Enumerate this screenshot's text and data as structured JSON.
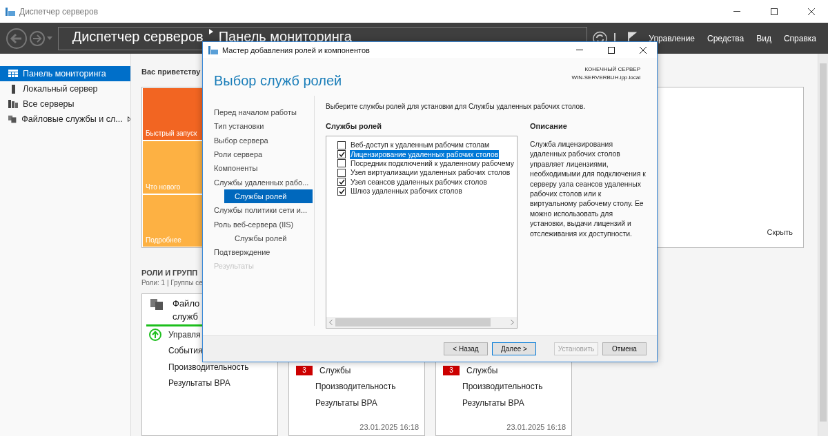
{
  "window": {
    "title": "Диспетчер серверов"
  },
  "toolbar": {
    "breadcrumb": [
      "Диспетчер серверов",
      "Панель мониторинга"
    ],
    "menu": [
      "Управление",
      "Средства",
      "Вид",
      "Справка"
    ]
  },
  "sidebar": {
    "items": [
      {
        "label": "Панель мониторинга",
        "kind": "dashboard",
        "selected": true,
        "has_submenu": false
      },
      {
        "label": "Локальный сервер",
        "kind": "server",
        "selected": false,
        "has_submenu": false
      },
      {
        "label": "Все серверы",
        "kind": "servers",
        "selected": false,
        "has_submenu": false
      },
      {
        "label": "Файловые службы и сл...",
        "kind": "files",
        "selected": false,
        "has_submenu": true
      }
    ]
  },
  "welcome": {
    "heading": "Вас приветству",
    "tiles": [
      {
        "label": "Быстрый запуск",
        "color": "#f26522"
      },
      {
        "label": "Что нового",
        "color": "#fdb143"
      },
      {
        "label": "Подробнее",
        "color": "#fdb143"
      }
    ],
    "hide_link": "Скрыть"
  },
  "roles": {
    "heading": "РОЛИ И ГРУПП",
    "summary": "Роли: 1 | Группы се",
    "cards": [
      {
        "title_lines": [
          "Файло",
          "служб"
        ],
        "rows": [
          {
            "label": "Управля",
            "kind": "status-ok"
          },
          {
            "label": "События",
            "kind": "plain"
          },
          {
            "label": "Производительность",
            "kind": "plain"
          },
          {
            "label": "Результаты BPA",
            "kind": "plain"
          }
        ]
      },
      {
        "rows": [
          {
            "label": "Службы",
            "kind": "badge",
            "badge": "3"
          },
          {
            "label": "Производительность",
            "kind": "plain"
          },
          {
            "label": "Результаты BPA",
            "kind": "plain"
          }
        ],
        "timestamp": "23.01.2025 16:18"
      },
      {
        "rows": [
          {
            "label": "Службы",
            "kind": "badge",
            "badge": "3"
          },
          {
            "label": "Производительность",
            "kind": "plain"
          },
          {
            "label": "Результаты BPA",
            "kind": "plain"
          }
        ],
        "timestamp": "23.01.2025 16:18"
      }
    ]
  },
  "dialog": {
    "title": "Мастер добавления ролей и компонентов",
    "heading": "Выбор служб ролей",
    "destination_label": "КОНЕЧНЫЙ СЕРВЕР",
    "destination_server": "WIN-SERVERBUH.ipp.local",
    "steps": [
      {
        "label": "Перед началом работы",
        "selected": false,
        "disabled": false
      },
      {
        "label": "Тип установки",
        "selected": false,
        "disabled": false
      },
      {
        "label": "Выбор сервера",
        "selected": false,
        "disabled": false
      },
      {
        "label": "Роли сервера",
        "selected": false,
        "disabled": false
      },
      {
        "label": "Компоненты",
        "selected": false,
        "disabled": false
      },
      {
        "label": "Службы удаленных рабо...",
        "selected": false,
        "disabled": false,
        "children": [
          {
            "label": "Службы ролей",
            "selected": true,
            "disabled": false
          }
        ]
      },
      {
        "label": "Службы политики сети и...",
        "selected": false,
        "disabled": false
      },
      {
        "label": "Роль веб-сервера (IIS)",
        "selected": false,
        "disabled": false,
        "children": [
          {
            "label": "Службы ролей",
            "selected": false,
            "disabled": false
          }
        ]
      },
      {
        "label": "Подтверждение",
        "selected": false,
        "disabled": false
      },
      {
        "label": "Результаты",
        "selected": false,
        "disabled": true
      }
    ],
    "instruction": "Выберите службы ролей для установки для Службы удаленных рабочих столов.",
    "services_heading": "Службы ролей",
    "services": [
      {
        "label": "Веб-доступ к удаленным рабочим столам",
        "checked": false,
        "selected": false
      },
      {
        "label": "Лицензирование удаленных рабочих столов",
        "checked": true,
        "selected": true
      },
      {
        "label": "Посредник подключений к удаленному рабочему",
        "checked": false,
        "selected": false
      },
      {
        "label": "Узел виртуализации удаленных рабочих столов",
        "checked": false,
        "selected": false
      },
      {
        "label": "Узел сеансов удаленных рабочих столов",
        "checked": true,
        "selected": false
      },
      {
        "label": "Шлюз удаленных рабочих столов",
        "checked": true,
        "selected": false
      }
    ],
    "description_heading": "Описание",
    "description": "Служба лицензирования удаленных рабочих столов управляет лицензиями, необходимыми для подключения к серверу узла сеансов удаленных рабочих столов или к виртуальному рабочему столу. Ее можно использовать для установки, выдачи лицензий и отслеживания их доступности.",
    "buttons": [
      {
        "label": "< Назад",
        "default": false,
        "disabled": false
      },
      {
        "label": "Далее >",
        "default": true,
        "disabled": false
      },
      {
        "label": "Установить",
        "default": false,
        "disabled": true
      },
      {
        "label": "Отмена",
        "default": false,
        "disabled": false
      }
    ]
  }
}
